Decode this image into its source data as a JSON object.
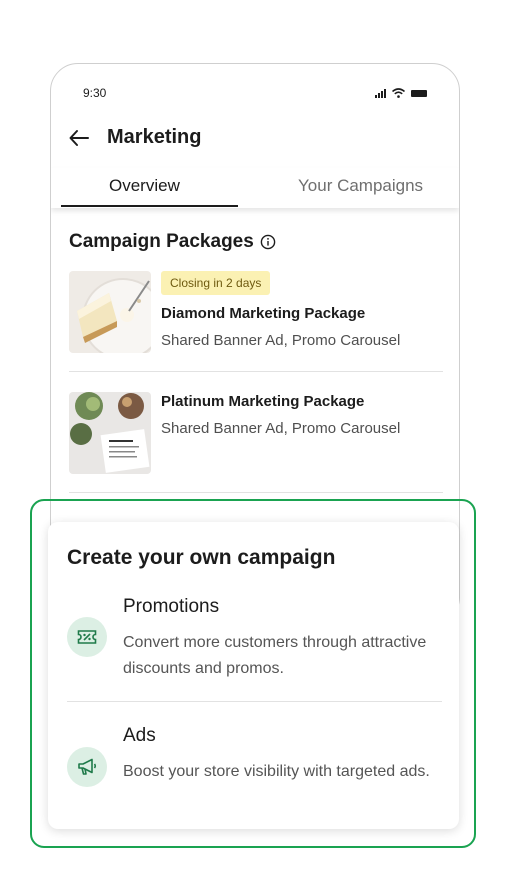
{
  "status_bar": {
    "time": "9:30"
  },
  "app_bar": {
    "title": "Marketing"
  },
  "tabs": [
    {
      "label": "Overview",
      "active": true
    },
    {
      "label": "Your Campaigns",
      "active": false
    }
  ],
  "packages_section": {
    "title": "Campaign Packages",
    "items": [
      {
        "badge": "Closing in 2 days",
        "name": "Diamond Marketing Package",
        "description": "Shared Banner Ad, Promo Carousel"
      },
      {
        "name": "Platinum Marketing Package",
        "description": "Shared Banner Ad, Promo Carousel"
      }
    ]
  },
  "create_campaign": {
    "title": "Create your own campaign",
    "options": [
      {
        "icon": "percent-ticket-icon",
        "title": "Promotions",
        "description": "Convert more customers through attractive discounts and promos."
      },
      {
        "icon": "megaphone-icon",
        "title": "Ads",
        "description": "Boost your store visibility with targeted ads."
      }
    ]
  },
  "colors": {
    "highlight_border": "#1aa351",
    "icon_bg": "#dcefe4",
    "icon_fg": "#1f7a4a",
    "badge_bg": "#fbf1b3"
  }
}
